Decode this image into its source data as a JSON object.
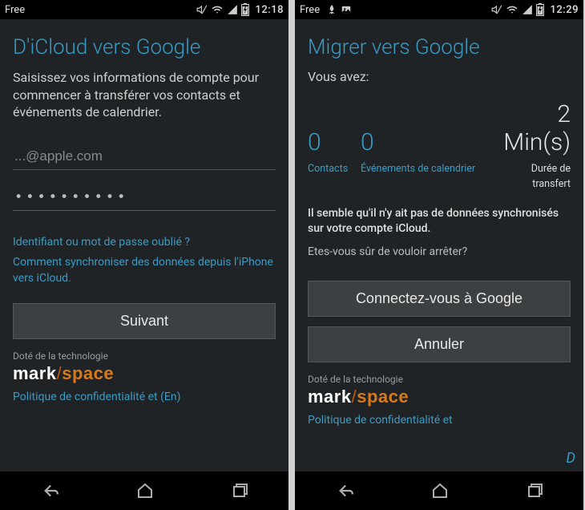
{
  "left": {
    "carrier": "Free",
    "clock": "12:18",
    "title": "D'iCloud vers Google",
    "subtitle": "Saisissez vos informations de compte pour commencer à transférer vos contacts et événements de calendrier.",
    "email_placeholder": "...@apple.com",
    "password_dots": "••••••••••",
    "forgot_link": "Identifiant ou mot de passe oublié ?",
    "sync_link": "Comment synchroniser des données depuis l'iPhone vers iCloud.",
    "next_button": "Suivant",
    "powered": "Doté de la technologie",
    "brand_mark": "mark",
    "brand_slash": "/",
    "brand_space": "space",
    "policy": "Politique de confidentialité et (En)"
  },
  "right": {
    "carrier": "Free",
    "clock": "12:29",
    "title": "Migrer vers Google",
    "you_have": "Vous avez:",
    "contacts_val": "0",
    "contacts_label": "Contacts",
    "events_val": "0",
    "events_label": "Événements de calendrier",
    "duration_val": "2 Min(s)",
    "duration_label": "Durée de transfert",
    "no_data": "Il semble qu'il n'y ait pas de données synchronisés sur votre compte iCloud.",
    "confirm": "Etes-vous sûr de vouloir arrêter?",
    "connect_button": "Connectez-vous à Google",
    "cancel_button": "Annuler",
    "powered": "Doté de la technologie",
    "brand_mark": "mark",
    "brand_slash": "/",
    "brand_space": "space",
    "policy": "Politique de confidentialité et"
  }
}
